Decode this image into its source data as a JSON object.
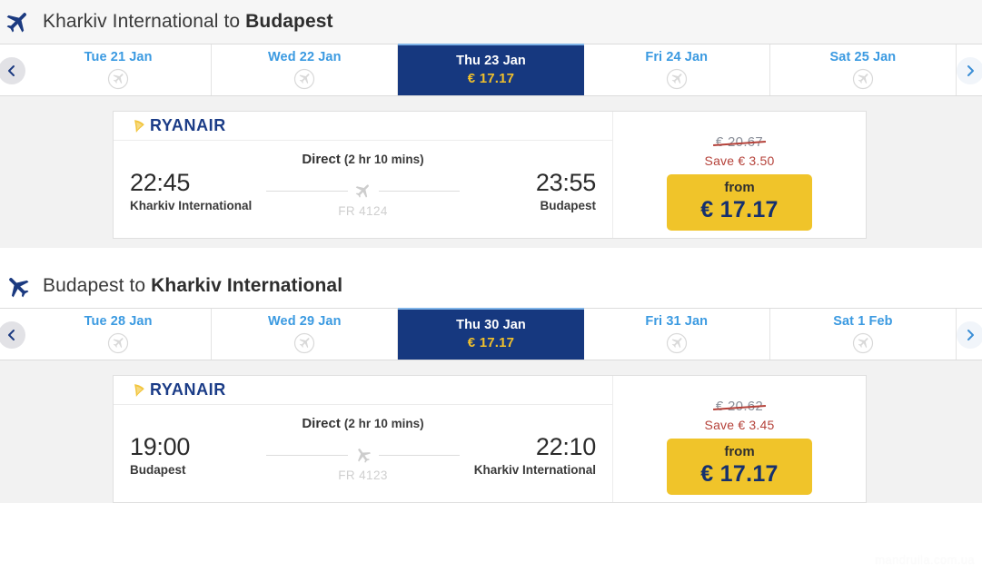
{
  "outbound": {
    "header": {
      "origin": "Kharkiv International",
      "connector": " to ",
      "destination": "Budapest",
      "plane_icon": "plane-depart-icon"
    },
    "nav": {
      "prev_icon": "chevron-left-icon",
      "next_icon": "chevron-right-icon"
    },
    "date_tabs": [
      {
        "day": "Tue 21 Jan",
        "price": "",
        "active": false,
        "icon": "plane-circle-icon"
      },
      {
        "day": "Wed 22 Jan",
        "price": "",
        "active": false,
        "icon": "plane-circle-icon"
      },
      {
        "day": "Thu 23 Jan",
        "price": "€ 17.17",
        "active": true,
        "icon": ""
      },
      {
        "day": "Fri 24 Jan",
        "price": "",
        "active": false,
        "icon": "plane-circle-icon"
      },
      {
        "day": "Sat 25 Jan",
        "price": "",
        "active": false,
        "icon": "plane-circle-icon"
      }
    ],
    "flight": {
      "airline": "RYANAIR",
      "airline_logo_icon": "ryanair-harp-icon",
      "stops": "Direct",
      "duration": "(2 hr 10 mins)",
      "depart_time": "22:45",
      "depart_airport": "Kharkiv International",
      "arrive_time": "23:55",
      "arrive_airport": "Budapest",
      "flight_number": "FR 4124",
      "plane_icon": "plane-icon"
    },
    "pricing": {
      "old_price": "€ 20.67",
      "save_text": "Save € 3.50",
      "from_label": "from",
      "price": "€ 17.17"
    }
  },
  "inbound": {
    "header": {
      "origin": "Budapest",
      "connector": " to ",
      "destination": "Kharkiv International",
      "plane_icon": "plane-return-icon"
    },
    "nav": {
      "prev_icon": "chevron-left-icon",
      "next_icon": "chevron-right-icon"
    },
    "date_tabs": [
      {
        "day": "Tue 28 Jan",
        "price": "",
        "active": false,
        "icon": "plane-circle-icon"
      },
      {
        "day": "Wed 29 Jan",
        "price": "",
        "active": false,
        "icon": "plane-circle-icon"
      },
      {
        "day": "Thu 30 Jan",
        "price": "€ 17.17",
        "active": true,
        "icon": ""
      },
      {
        "day": "Fri 31 Jan",
        "price": "",
        "active": false,
        "icon": "plane-circle-icon"
      },
      {
        "day": "Sat 1 Feb",
        "price": "",
        "active": false,
        "icon": "plane-circle-icon"
      }
    ],
    "flight": {
      "airline": "RYANAIR",
      "airline_logo_icon": "ryanair-harp-icon",
      "stops": "Direct",
      "duration": "(2 hr 10 mins)",
      "depart_time": "19:00",
      "depart_airport": "Budapest",
      "arrive_time": "22:10",
      "arrive_airport": "Kharkiv International",
      "flight_number": "FR 4123",
      "plane_icon": "plane-icon"
    },
    "pricing": {
      "old_price": "€ 20.62",
      "save_text": "Save € 3.45",
      "from_label": "from",
      "price": "€ 17.17"
    }
  },
  "watermark": "mandruila.com.ua",
  "colors": {
    "active_tab_bg": "#16387f",
    "tab_day": "#3b9ae1",
    "tab_price": "#f0c02c",
    "price_button_bg": "#f0c42a",
    "price_button_text": "#15306e",
    "save_text": "#b5423a",
    "airline_navy": "#1b3c87"
  }
}
